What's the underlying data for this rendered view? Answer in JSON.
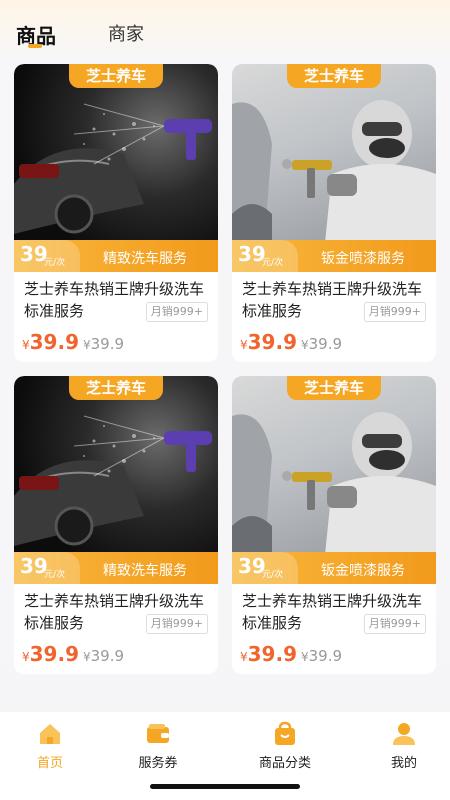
{
  "tabs": [
    {
      "label": "商品",
      "active": true
    },
    {
      "label": "商家",
      "active": false
    }
  ],
  "products": [
    {
      "brand": "芝士养车",
      "price_tag": "39",
      "price_unit": "元/次",
      "service": "精致洗车服务",
      "title": "芝士养车热销王牌升级洗车标准服务",
      "sales": "月销999+",
      "price": "39.9",
      "original_price": "39.9",
      "image": "car-wash"
    },
    {
      "brand": "芝士养车",
      "price_tag": "39",
      "price_unit": "元/次",
      "service": "钣金喷漆服务",
      "title": "芝士养车热销王牌升级洗车标准服务",
      "sales": "月销999+",
      "price": "39.9",
      "original_price": "39.9",
      "image": "spray-painting"
    },
    {
      "brand": "芝士养车",
      "price_tag": "39",
      "price_unit": "元/次",
      "service": "精致洗车服务",
      "title": "芝士养车热销王牌升级洗车标准服务",
      "sales": "月销999+",
      "price": "39.9",
      "original_price": "39.9",
      "image": "car-wash"
    },
    {
      "brand": "芝士养车",
      "price_tag": "39",
      "price_unit": "元/次",
      "service": "钣金喷漆服务",
      "title": "芝士养车热销王牌升级洗车标准服务",
      "sales": "月销999+",
      "price": "39.9",
      "original_price": "39.9",
      "image": "spray-painting"
    }
  ],
  "currency": "¥",
  "nav": [
    {
      "label": "首页",
      "icon": "home-icon",
      "active": true
    },
    {
      "label": "服务券",
      "icon": "wallet-icon",
      "active": false
    },
    {
      "label": "商品分类",
      "icon": "shopping-bag-icon",
      "active": false
    },
    {
      "label": "我的",
      "icon": "user-icon",
      "active": false
    }
  ],
  "colors": {
    "accent": "#F5A623",
    "price": "#F0652E"
  }
}
